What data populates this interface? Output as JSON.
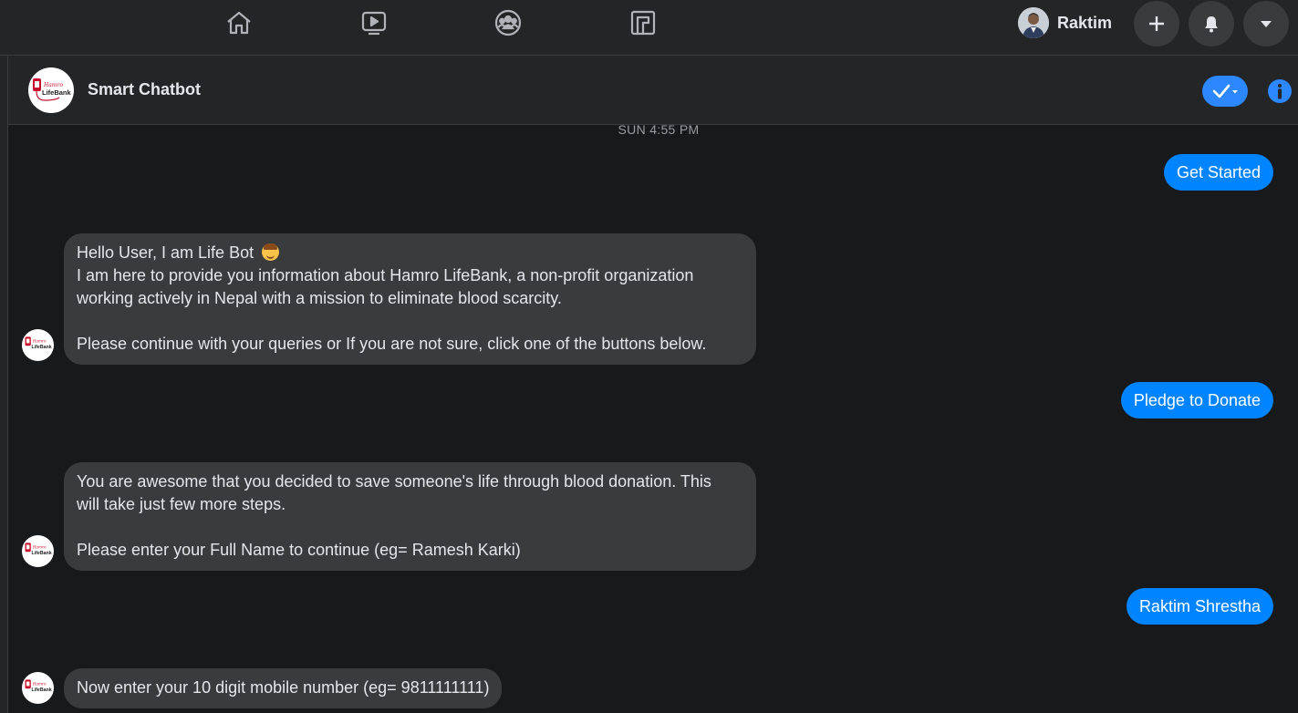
{
  "topbar": {
    "nav_icons": [
      "home-icon",
      "watch-icon",
      "groups-icon",
      "gaming-icon"
    ],
    "profile_name": "Raktim",
    "action_icons": [
      "plus-icon",
      "bell-icon",
      "caret-down-icon"
    ]
  },
  "chat": {
    "title": "Smart Chatbot",
    "logo_text": "Hamro LifeBank",
    "timestamp": "SUN 4:55 PM",
    "messages": [
      {
        "from": "user",
        "text": "Get Started"
      },
      {
        "from": "bot",
        "line1": "Hello User, I am Life Bot",
        "line2": "I am here to provide you information about Hamro LifeBank, a non-profit organization",
        "line3": "working actively in Nepal with a mission to eliminate blood scarcity.",
        "line4": "Please continue with your queries or If you are not sure, click one of the buttons below."
      },
      {
        "from": "user",
        "text": "Pledge to Donate"
      },
      {
        "from": "bot",
        "line1": "You are awesome that you decided to save someone's life through blood donation. This",
        "line2": "will take just few more steps.",
        "line3": "Please enter your Full Name to continue (eg= Ramesh Karki)"
      },
      {
        "from": "user",
        "text": "Raktim Shrestha"
      },
      {
        "from": "bot",
        "line1": "Now enter your 10 digit mobile number (eg= 9811111111)"
      }
    ]
  },
  "colors": {
    "page_bg": "#18191a",
    "bar_bg": "#242526",
    "user_bubble": "#0084ff",
    "bot_bubble": "#3a3b3c",
    "accent": "#2d88ff"
  }
}
